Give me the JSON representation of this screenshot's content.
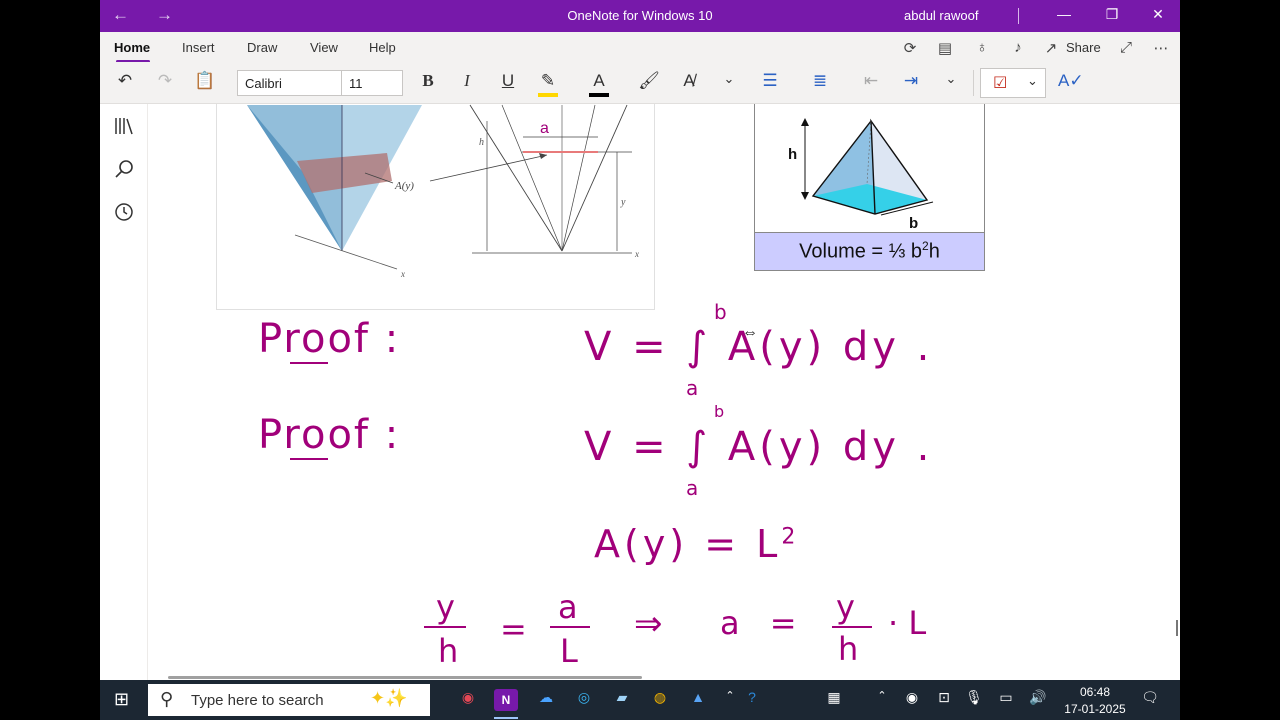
{
  "window": {
    "title": "OneNote for Windows 10",
    "user": "abdul rawoof"
  },
  "ribbon": {
    "tabs": [
      "Home",
      "Insert",
      "Draw",
      "View",
      "Help"
    ],
    "share_label": "Share",
    "font_name": "Calibri",
    "font_size": "11",
    "font_color": "#000000",
    "highlight_color": "#ffd700",
    "accent": "#7719aa"
  },
  "figures": {
    "frustum_labels": {
      "area": "A(y)",
      "x_axis": "x",
      "h": "h",
      "y": "y",
      "a": "a",
      "x": "x"
    },
    "pyramid": {
      "h": "h",
      "b": "b",
      "formula_prefix": "Volume = ",
      "formula_frac": "⅓",
      "formula_b": " b",
      "formula_sup": "2",
      "formula_h": "h"
    }
  },
  "notes": {
    "proof1": "Proof :",
    "eq1": "V = ∫ A(y) dy .",
    "eq1_upper": "b",
    "eq1_lower": "a",
    "proof2": "Proof :",
    "eq2": "V = ∫ A(y) dy .",
    "eq2_upper": "b",
    "eq2_lower": "a",
    "eq3": "A(y) = L",
    "eq3_sup": "2",
    "frac1_num": "y",
    "frac1_den": "h",
    "eq_sign": "=",
    "frac2_num": "a",
    "frac2_den": "L",
    "implies": "⇒",
    "a_eq": "a =",
    "frac3_num": "y",
    "frac3_den": "h",
    "tail": "· L",
    "ink_color": "#a1007a"
  },
  "taskbar": {
    "search_placeholder": "Type here to search",
    "time": "06:48",
    "date": "17-01-2025"
  }
}
